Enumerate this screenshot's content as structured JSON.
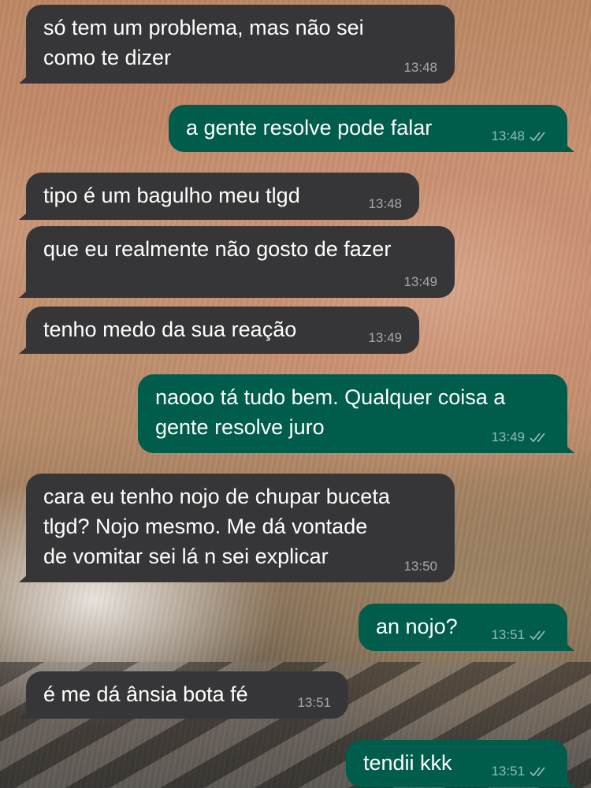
{
  "messages": [
    {
      "direction": "in",
      "text": "só tem um problema, mas não sei\ncomo te dizer",
      "time": "13:48"
    },
    {
      "direction": "out",
      "text": "a gente resolve pode falar",
      "time": "13:48"
    },
    {
      "direction": "in",
      "text": "tipo é um bagulho meu tlgd",
      "time": "13:48"
    },
    {
      "direction": "in",
      "text": "que eu realmente não gosto de fazer",
      "time": "13:49"
    },
    {
      "direction": "in",
      "text": "tenho medo da sua reação",
      "time": "13:49"
    },
    {
      "direction": "out",
      "text": "naooo tá tudo bem. Qualquer coisa a\ngente resolve juro",
      "time": "13:49"
    },
    {
      "direction": "in",
      "text": "cara eu tenho nojo de chupar buceta\ntlgd? Nojo mesmo. Me dá vontade\nde vomitar sei lá n sei explicar",
      "time": "13:50"
    },
    {
      "direction": "out",
      "text": "an nojo?",
      "time": "13:51"
    },
    {
      "direction": "in",
      "text": "é me dá ânsia bota fé",
      "time": "13:51"
    },
    {
      "direction": "out",
      "text": "tendii kkk",
      "time": "13:51"
    }
  ],
  "icons": {
    "read_receipt": "double-check-icon"
  },
  "colors": {
    "incoming_bubble": "#363638",
    "outgoing_bubble": "#005c4b",
    "text": "#ffffff"
  }
}
